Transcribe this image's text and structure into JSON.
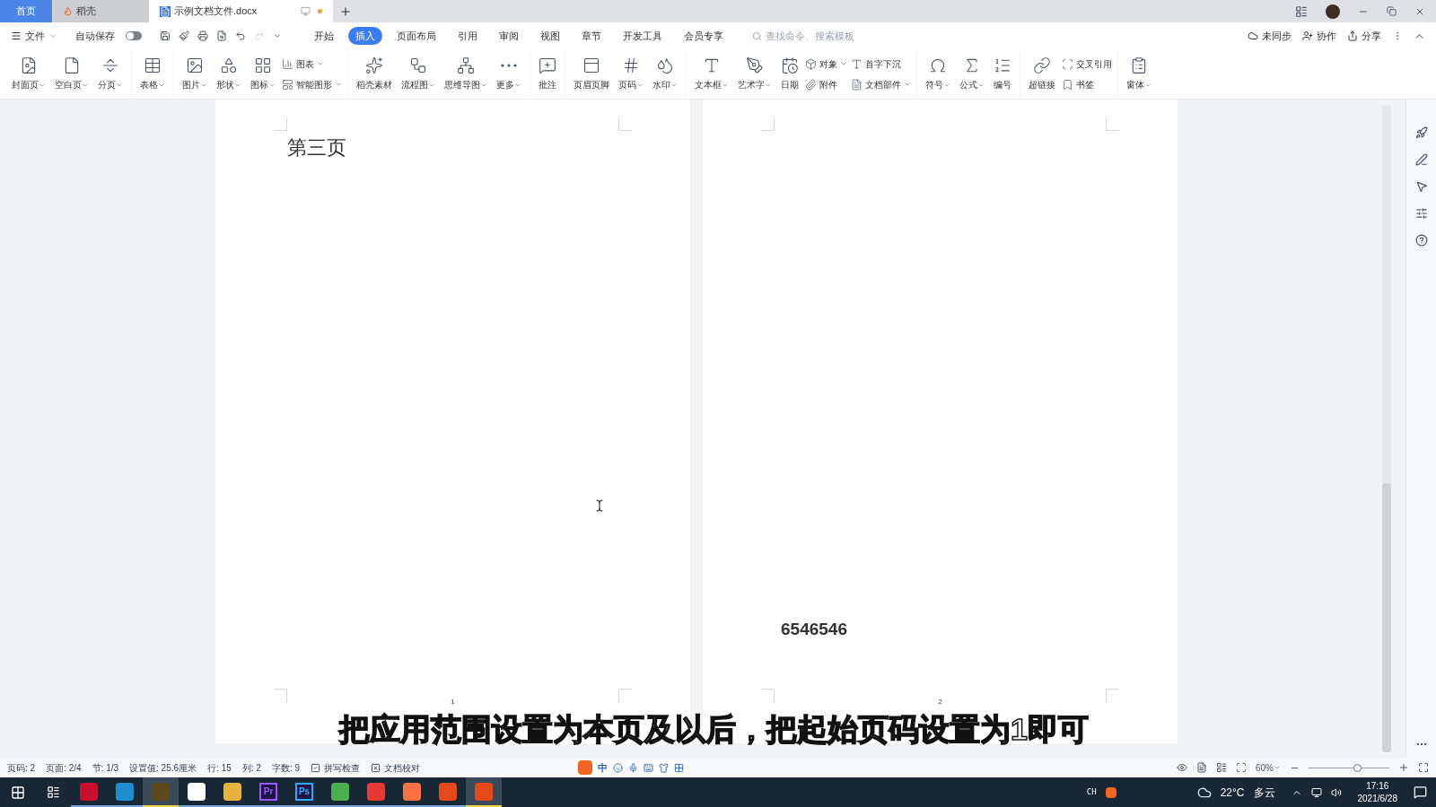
{
  "tabs": [
    {
      "kind": "home",
      "label": "首页",
      "selected": false
    },
    {
      "kind": "app",
      "label": "稻壳",
      "selected": false
    },
    {
      "kind": "doc",
      "label": "示例文档文件.docx",
      "selected": true,
      "unsaved": true
    }
  ],
  "menu": {
    "file": "文件",
    "autosave": {
      "label": "自动保存",
      "on": false
    },
    "tabs": [
      {
        "label": "开始",
        "selected": false
      },
      {
        "label": "插入",
        "selected": true
      },
      {
        "label": "页面布局",
        "selected": false
      },
      {
        "label": "引用",
        "selected": false
      },
      {
        "label": "审阅",
        "selected": false
      },
      {
        "label": "视图",
        "selected": false
      },
      {
        "label": "章节",
        "selected": false
      },
      {
        "label": "开发工具",
        "selected": false
      },
      {
        "label": "会员专享",
        "selected": false
      }
    ],
    "search": {
      "placeholder": "查找命令、搜索模板"
    },
    "actions": [
      "未同步",
      "协作",
      "分享"
    ]
  },
  "ribbon": [
    [
      {
        "kind": "large",
        "label": "封面页",
        "dropdown": true
      },
      {
        "kind": "large",
        "label": "空白页",
        "dropdown": true
      },
      {
        "kind": "large",
        "label": "分页",
        "dropdown": true
      }
    ],
    [
      {
        "kind": "large",
        "label": "表格",
        "dropdown": true
      }
    ],
    [
      {
        "kind": "large",
        "label": "图片",
        "dropdown": true
      },
      {
        "kind": "large",
        "label": "形状",
        "dropdown": true
      },
      {
        "kind": "large",
        "label": "图标",
        "dropdown": true
      },
      {
        "kind": "stack",
        "items": [
          {
            "label": "图表",
            "dropdown": true
          },
          {
            "label": "智能图形",
            "dropdown": true
          }
        ]
      }
    ],
    [
      {
        "kind": "large",
        "label": "稻壳素材",
        "dropdown": false
      },
      {
        "kind": "large",
        "label": "流程图",
        "dropdown": true
      },
      {
        "kind": "large",
        "label": "思维导图",
        "dropdown": true
      },
      {
        "kind": "large",
        "label": "更多",
        "dropdown": true
      }
    ],
    [
      {
        "kind": "large",
        "label": "批注",
        "dropdown": false
      }
    ],
    [
      {
        "kind": "large",
        "label": "页眉页脚",
        "dropdown": false
      },
      {
        "kind": "large",
        "label": "页码",
        "dropdown": true
      },
      {
        "kind": "large",
        "label": "水印",
        "dropdown": true
      }
    ],
    [
      {
        "kind": "large",
        "label": "文本框",
        "dropdown": true
      },
      {
        "kind": "large",
        "label": "艺术字",
        "dropdown": true
      },
      {
        "kind": "large",
        "label": "日期",
        "dropdown": false
      },
      {
        "kind": "stack",
        "items": [
          {
            "label": "对象",
            "dropdown": true
          },
          {
            "label": "附件",
            "dropdown": false
          }
        ]
      },
      {
        "kind": "stack",
        "items": [
          {
            "label": "首字下沉",
            "dropdown": false
          },
          {
            "label": "文档部件",
            "dropdown": true
          }
        ]
      }
    ],
    [
      {
        "kind": "large",
        "label": "符号",
        "dropdown": true
      },
      {
        "kind": "large",
        "label": "公式",
        "dropdown": true
      },
      {
        "kind": "large",
        "label": "编号",
        "dropdown": false
      }
    ],
    [
      {
        "kind": "large",
        "label": "超链接",
        "dropdown": false
      },
      {
        "kind": "stack",
        "items": [
          {
            "label": "交叉引用",
            "dropdown": false
          },
          {
            "label": "书签",
            "dropdown": false
          }
        ]
      }
    ],
    [
      {
        "kind": "large",
        "label": "窗体",
        "dropdown": true
      }
    ]
  ],
  "pages": [
    {
      "heading": "第三页",
      "number": "1"
    },
    {
      "body": "6546546",
      "number": "2"
    }
  ],
  "caption": "把应用范围设置为本页及以后，把起始页码设置为1即可",
  "status_bar": {
    "items": [
      "页码: 2",
      "页面: 2/4",
      "节: 1/3",
      "设置值: 25.6厘米",
      "行: 15",
      "列: 2",
      "字数: 9"
    ],
    "checks": [
      "拼写检查",
      "文档校对"
    ],
    "ime": "中",
    "zoom": "60%",
    "level": 0.6
  },
  "taskbar": {
    "apps": [
      {
        "kind": "icon",
        "color": "#c8102e",
        "active": false
      },
      {
        "kind": "icon",
        "color": "#1d8fd1",
        "active": false
      },
      {
        "kind": "icon",
        "color": "#5c4a1e",
        "active": true
      },
      {
        "kind": "icon",
        "color": "#ffffff",
        "active": false
      },
      {
        "kind": "icon",
        "color": "#e8b33c",
        "active": false
      },
      {
        "kind": "text",
        "label": "Pr",
        "color": "#9b59ff",
        "active": false
      },
      {
        "kind": "text",
        "label": "Ps",
        "color": "#31a8ff",
        "active": false
      },
      {
        "kind": "icon",
        "color": "#4caf50",
        "active": false
      },
      {
        "kind": "icon",
        "color": "#e53935",
        "active": false
      },
      {
        "kind": "icon",
        "color": "#ff7043",
        "active": false
      },
      {
        "kind": "icon",
        "color": "#e64a19",
        "active": false
      },
      {
        "kind": "icon",
        "color": "#e64a19",
        "active": true
      }
    ],
    "lang": "CH",
    "weather": "22°C",
    "sky": "多云",
    "time": "17:16",
    "date": "2021/6/28"
  }
}
